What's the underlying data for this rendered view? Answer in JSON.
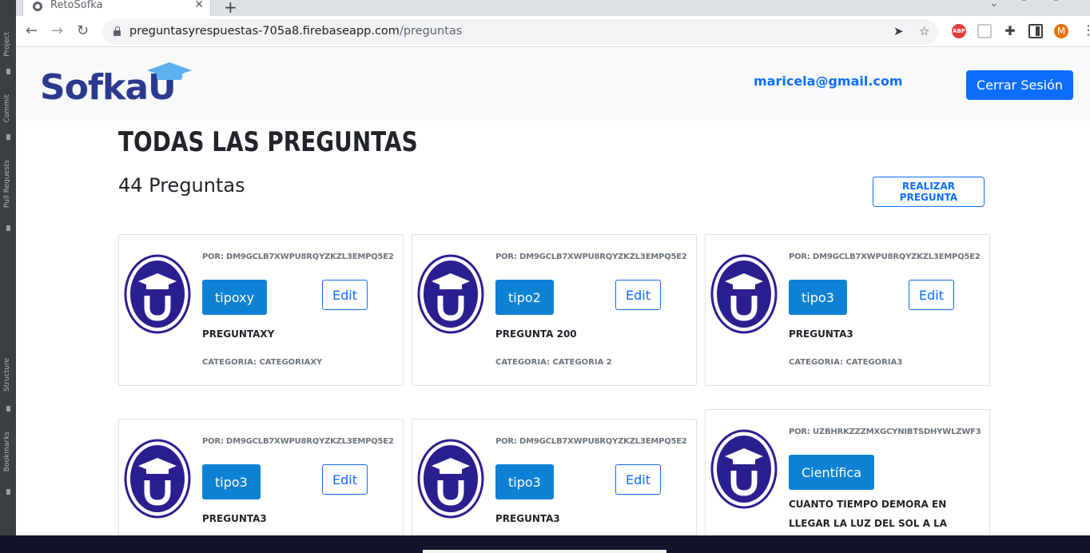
{
  "ide_sidebar": {
    "labels": [
      "Project",
      "Commit",
      "Pull Requests",
      "Structure",
      "Bookmarks"
    ]
  },
  "browser": {
    "tab_title": "RetoSofka",
    "url_host": "preguntasyrespuestas-705a8.firebaseapp.com",
    "url_path": "/preguntas",
    "extensions": {
      "abp_label": "ABP",
      "profile_initial": "M"
    }
  },
  "header": {
    "logo_text": "Sofka",
    "logo_letter": "U",
    "user_email": "maricela@gmail.com",
    "logout_label": "Cerrar Sesión"
  },
  "main": {
    "title": "TODAS LAS PREGUNTAS",
    "count_label": "44 Preguntas",
    "ask_button": "REALIZAR PREGUNTA"
  },
  "cards": [
    {
      "by": "POR: DM9GCLB7XWPU8RQYZKZL3EMPQ5E2",
      "type": "tipoxy",
      "edit": "Edit",
      "question": "PREGUNTAXY",
      "category": "CATEGORIA: CATEGORIAXY"
    },
    {
      "by": "POR: DM9GCLB7XWPU8RQYZKZL3EMPQ5E2",
      "type": "tipo2",
      "edit": "Edit",
      "question": "PREGUNTA 200",
      "category": "CATEGORIA: CATEGORIA 2"
    },
    {
      "by": "POR: DM9GCLB7XWPU8RQYZKZL3EMPQ5E2",
      "type": "tipo3",
      "edit": "Edit",
      "question": "PREGUNTA3",
      "category": "CATEGORIA: CATEGORIA3"
    },
    {
      "by": "POR: DM9GCLB7XWPU8RQYZKZL3EMPQ5E2",
      "type": "tipo3",
      "edit": "Edit",
      "question": "PREGUNTA3",
      "category": ""
    },
    {
      "by": "POR: DM9GCLB7XWPU8RQYZKZL3EMPQ5E2",
      "type": "tipo3",
      "edit": "Edit",
      "question": "PREGUNTA3",
      "category": ""
    },
    {
      "by": "POR: UZBHRKZZZMXGCYNIBTSDHYWLZWF3",
      "type": "Científica",
      "edit": "",
      "question": "CUANTO TIEMPO DEMORA EN LLEGAR LA LUZ DEL SOL A LA TIERRA",
      "category": ""
    }
  ],
  "colors": {
    "primary": "#0d6efd",
    "type_button": "#0d82d4",
    "logo_navy": "#2b3a8f",
    "logo_cap": "#5bb0f0"
  }
}
